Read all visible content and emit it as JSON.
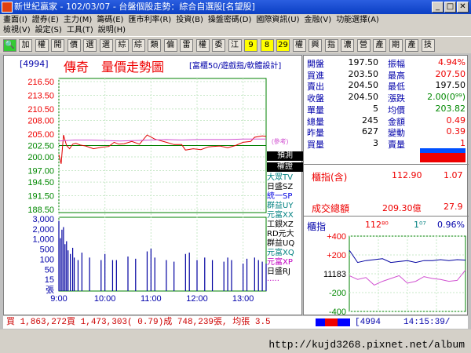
{
  "window": {
    "title": "新世紀贏家 - 102/03/07 - 台盤個股走勢：綜合自選股[名望股]"
  },
  "menu": {
    "row1": [
      "畫面(I)",
      "證券(E)",
      "主力(M)",
      "籌碼(E)",
      "匯市利率(R)",
      "投資(B)",
      "操盤密碼(D)",
      "國際資訊(U)",
      "金融(V)",
      "功能選擇(A)"
    ],
    "row2": [
      "檢視(V)",
      "設定(S)",
      "工具(T)",
      "說明(H)"
    ]
  },
  "toolbar": {
    "items": [
      "加",
      "權",
      "開",
      "價",
      "選",
      "選",
      "綜",
      "綜",
      "類",
      "偏",
      "雷",
      "權",
      "委",
      "江",
      "9",
      "8",
      "29",
      "權",
      "興",
      "指",
      "濃",
      "營",
      "產",
      "期",
      "產",
      "技"
    ]
  },
  "chart": {
    "header_code": "[4994]",
    "header_name": "傳奇",
    "header_title": "量價走勢圖",
    "header_sub": "[富櫃50/遊戲指/軟體設計]",
    "price_ticks": [
      "216.50",
      "213.50",
      "210.50",
      "208.00",
      "205.00",
      "202.50",
      "200.00",
      "197.00",
      "194.50",
      "191.50",
      "188.50"
    ],
    "vol_ticks": [
      "3,000",
      "2,000",
      "1,000",
      "500",
      "100",
      "50",
      "15",
      "張"
    ],
    "time_ticks": [
      "9:00",
      "10:00",
      "11:00",
      "12:00",
      "13:00"
    ],
    "ref_label": "(參考)"
  },
  "chart_data": {
    "type": "line",
    "xlabel": "",
    "ylabel": "",
    "ylim": [
      188.5,
      216.5
    ],
    "xlim_minutes": [
      0,
      270
    ],
    "series": [
      {
        "name": "",
        "color": "#e00000",
        "x": [
          0,
          3,
          6,
          10,
          14,
          18,
          22,
          28,
          35,
          45,
          55,
          65,
          72,
          78,
          85,
          95,
          105,
          115,
          125,
          140,
          150,
          160,
          165,
          175,
          185,
          195,
          200,
          210,
          220,
          230,
          240,
          250,
          255,
          265,
          270
        ],
        "y": [
          200.5,
          198.5,
          204.8,
          202.5,
          201.8,
          202.8,
          203.0,
          202.6,
          202.4,
          201.8,
          202.1,
          202.3,
          203.2,
          202.8,
          202.9,
          203.4,
          202.8,
          204.8,
          203.9,
          203.2,
          202.7,
          202.7,
          201.5,
          201.8,
          201.6,
          202.2,
          202.3,
          202.4,
          202.0,
          202.5,
          203.2,
          203.4,
          204.3,
          204.6,
          204.5
        ]
      },
      {
        "name": "",
        "color": "#d050d0",
        "x": [
          0,
          20,
          40,
          60,
          80,
          100,
          120,
          140,
          160,
          180,
          200,
          220,
          240,
          260,
          270
        ],
        "y": [
          203.5,
          203.7,
          203.7,
          203.6,
          203.5,
          203.6,
          203.7,
          203.8,
          203.7,
          203.8,
          203.8,
          203.8,
          203.9,
          203.9,
          203.9
        ]
      }
    ],
    "volume": {
      "x": [
        0,
        2,
        4,
        6,
        8,
        10,
        12,
        15,
        18,
        20,
        25,
        30,
        40,
        55,
        60,
        70,
        75,
        90,
        100,
        115,
        120,
        125,
        140,
        150,
        165,
        170,
        180,
        190,
        200,
        215,
        220,
        225,
        240,
        245,
        255,
        260,
        265,
        270
      ],
      "v": [
        2400,
        350,
        900,
        1200,
        180,
        250,
        90,
        60,
        120,
        40,
        30,
        70,
        40,
        30,
        60,
        30,
        30,
        45,
        35,
        80,
        110,
        40,
        30,
        25,
        60,
        70,
        30,
        40,
        30,
        25,
        40,
        30,
        20,
        35,
        40,
        30,
        25,
        20
      ]
    }
  },
  "overlay": {
    "items": [
      {
        "label": "預測",
        "fg": "#ffffff",
        "bg": "#000000"
      },
      {
        "label": "權證",
        "fg": "#ffffff",
        "bg": "#000000"
      },
      {
        "label": "大眾TV",
        "fg": "#008080",
        "bg": ""
      },
      {
        "label": "日盛SZ",
        "fg": "#000000",
        "bg": ""
      },
      {
        "label": "統一SP",
        "fg": "#0000e0",
        "bg": ""
      },
      {
        "label": "群益UY",
        "fg": "#008080",
        "bg": ""
      },
      {
        "label": "元富XX",
        "fg": "#008080",
        "bg": ""
      },
      {
        "label": "工銀XZ",
        "fg": "#000000",
        "bg": ""
      },
      {
        "label": "RD元大",
        "fg": "#000000",
        "bg": ""
      },
      {
        "label": "群益UQ",
        "fg": "#000000",
        "bg": ""
      },
      {
        "label": "元富XQ",
        "fg": "#008080",
        "bg": ""
      },
      {
        "label": "元富XP",
        "fg": "#c000c0",
        "bg": ""
      },
      {
        "label": "日盛RJ",
        "fg": "#000000",
        "bg": ""
      },
      {
        "label": "·····",
        "fg": "#c000c0",
        "bg": ""
      }
    ]
  },
  "quote": {
    "rows": [
      {
        "k": "開盤",
        "v": "197.50",
        "vc": "grn",
        "k2": "振幅",
        "v2": "4.94%",
        "v2c": "red"
      },
      {
        "k": "買進",
        "v": "203.50",
        "vc": "grn",
        "k2": "最高",
        "v2": "207.50",
        "v2c": "red"
      },
      {
        "k": "賣出",
        "v": "204.50",
        "vc": "grn",
        "k2": "最低",
        "v2": "197.50",
        "v2c": "blk"
      },
      {
        "k": "收盤",
        "v": "204.50",
        "vc": "grn",
        "k2": "漲跌",
        "v2": "2.00(0⁹⁹)",
        "v2c": "grn"
      },
      {
        "k": "單量",
        "v": "5",
        "vc": "red",
        "k2": "均價",
        "v2": "203.82",
        "v2c": "grn"
      },
      {
        "k": "總量",
        "v": "245",
        "vc": "red",
        "k2": "金額",
        "v2": "0.49",
        "v2c": "red"
      },
      {
        "k": "昨量",
        "v": "627",
        "vc": "red",
        "k2": "變動",
        "v2": "0.39",
        "v2c": "red"
      },
      {
        "k": "買量",
        "v": "3",
        "vc": "red",
        "k2": "賣量",
        "v2": "1",
        "v2c": "red"
      }
    ]
  },
  "index": {
    "label1": "櫃指(含)",
    "val1": "112.90",
    "val2": "1.07",
    "label2": "成交總額",
    "val3": "209.30億",
    "val4": "27.9"
  },
  "otc": {
    "title": "櫃指",
    "value": "112⁸⁰",
    "change": "1⁰⁷",
    "pct": "0.96%",
    "ticks": [
      "+400",
      "+200",
      "11183",
      "-200",
      "-400"
    ]
  },
  "otc_chart": {
    "type": "line",
    "series": [
      {
        "name": "",
        "color": "#0000a0",
        "x": [
          0,
          10,
          20,
          30,
          40,
          50,
          60,
          70,
          80,
          90,
          100,
          110,
          120,
          130,
          140
        ],
        "y": [
          250,
          120,
          140,
          150,
          160,
          120,
          130,
          140,
          120,
          140,
          140,
          150,
          140,
          150,
          145
        ]
      },
      {
        "name": "",
        "color": "#d050d0",
        "x": [
          0,
          10,
          20,
          30,
          40,
          50,
          60,
          70,
          80,
          90,
          100,
          110,
          120,
          130,
          140
        ],
        "y": [
          -20,
          -60,
          -40,
          -120,
          -80,
          -50,
          -20,
          -100,
          -80,
          -30,
          -50,
          -60,
          -80,
          -70,
          40
        ]
      }
    ]
  },
  "status": {
    "text": "買 1,863,272買 1,473,303( 0.79)成 748,239張, 均張 3.5",
    "code": "[4994",
    "time": "14:15:39/"
  },
  "footer": {
    "watermark": "http://kujd3268.pixnet.net/album"
  }
}
